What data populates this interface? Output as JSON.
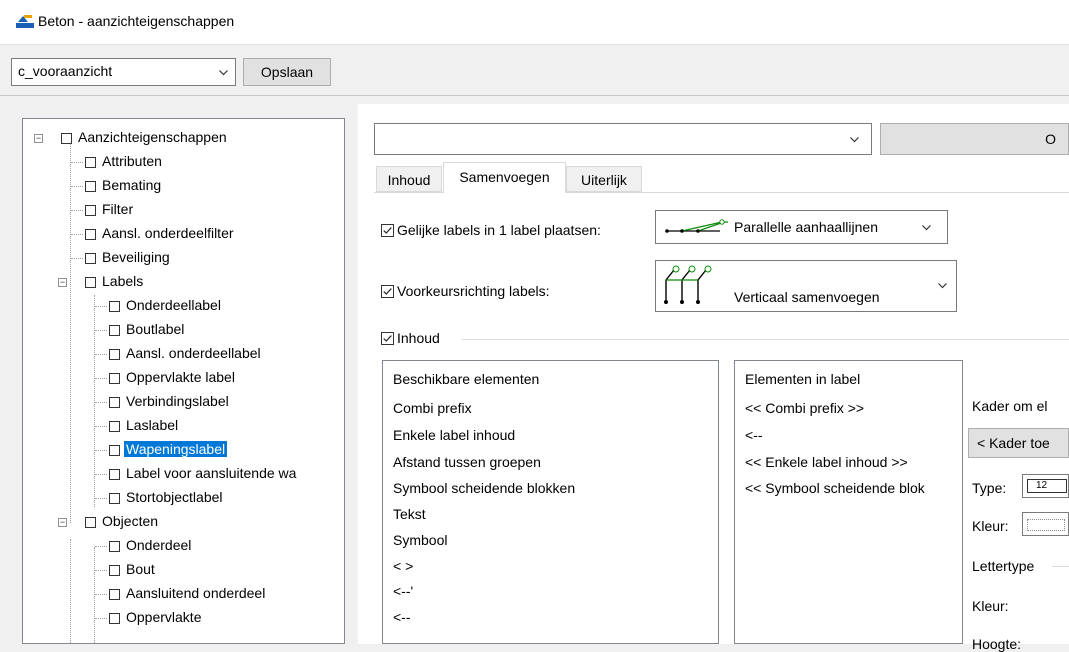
{
  "window": {
    "title": "Beton - aanzichteigenschappen"
  },
  "preset": {
    "value": "c_vooraanzicht",
    "save_label": "Opslaan"
  },
  "tree": {
    "root": "Aanzichteigenschappen",
    "items": [
      {
        "label": "Attributen"
      },
      {
        "label": "Bemating"
      },
      {
        "label": "Filter"
      },
      {
        "label": "Aansl. onderdeelfilter"
      },
      {
        "label": "Beveiliging"
      },
      {
        "label": "Labels"
      },
      {
        "label": "Onderdeellabel"
      },
      {
        "label": "Boutlabel"
      },
      {
        "label": "Aansl. onderdeellabel"
      },
      {
        "label": "Oppervlakte label"
      },
      {
        "label": "Verbindingslabel"
      },
      {
        "label": "Laslabel"
      },
      {
        "label": "Wapeningslabel"
      },
      {
        "label": "Label voor aansluitende wa"
      },
      {
        "label": "Stortobjectlabel"
      },
      {
        "label": "Objecten"
      },
      {
        "label": "Onderdeel"
      },
      {
        "label": "Bout"
      },
      {
        "label": "Aansluitend onderdeel"
      },
      {
        "label": "Oppervlakte"
      }
    ]
  },
  "right": {
    "combo_value": "",
    "button_partial": "O",
    "tabs": [
      "Inhoud",
      "Samenvoegen",
      "Uiterlijk"
    ],
    "active_tab": "Samenvoegen",
    "merge_same": {
      "label": "Gelijke labels in 1 label plaatsen:",
      "checked": true,
      "option": "Parallelle aanhaallijnen",
      "icon": "parallel-leaders-icon"
    },
    "pref_dir": {
      "label": "Voorkeursrichting labels:",
      "checked": true,
      "option": "Verticaal  samenvoegen",
      "icon": "vertical-merge-icon"
    },
    "content": {
      "label": "Inhoud",
      "checked": true
    },
    "available": {
      "header": "Beschikbare elementen",
      "items": [
        "Combi prefix",
        "Enkele label inhoud",
        "Afstand tussen groepen",
        "Symbool scheidende blokken",
        "Tekst",
        "Symbool",
        "< >",
        "<--'",
        "<--"
      ]
    },
    "in_label": {
      "header": "Elementen in label",
      "items": [
        "<< Combi prefix >>",
        "<--",
        "<< Enkele label inhoud >>",
        "<< Symbool scheidende blok"
      ]
    },
    "frame": {
      "title": "Kader om el",
      "button": "< Kader toe",
      "type_label": "Type:",
      "type_value": "12",
      "color_label": "Kleur:",
      "font_label": "Lettertype",
      "font_color_label": "Kleur:",
      "height_label": "Hoogte:"
    }
  }
}
